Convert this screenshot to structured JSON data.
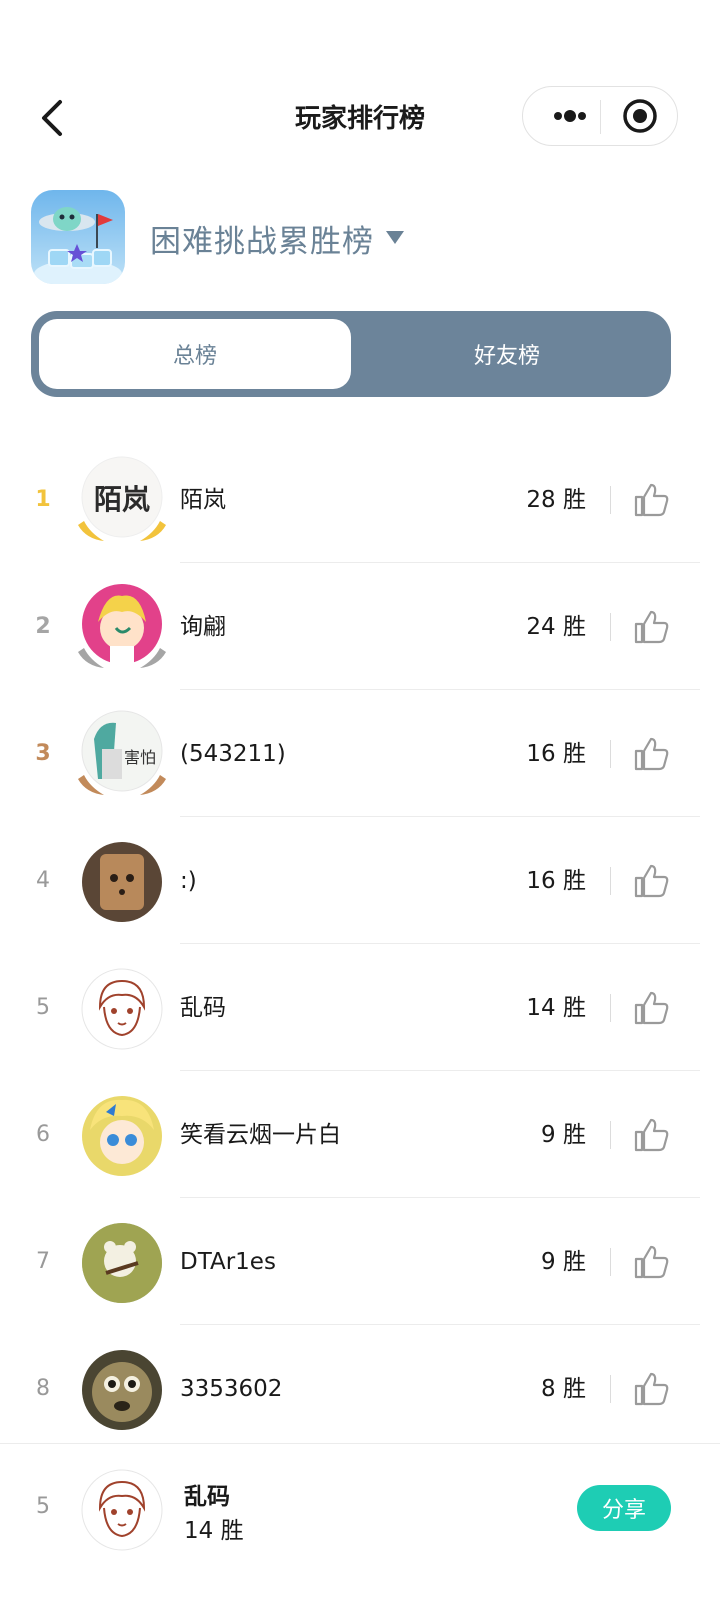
{
  "header": {
    "title": "玩家排行榜"
  },
  "board": {
    "name": "困难挑战累胜榜"
  },
  "tabs": [
    {
      "label": "总榜",
      "active": true
    },
    {
      "label": "好友榜",
      "active": false
    }
  ],
  "colors": {
    "accent": "#6c849a",
    "share": "#1ecdb4",
    "gold": "#f2c33c",
    "silver": "#a5a5a5",
    "bronze": "#c28a5a"
  },
  "leaderboard": [
    {
      "rank": "1",
      "name": "陌岚",
      "score": "28 胜",
      "avatar_text": "陌岚"
    },
    {
      "rank": "2",
      "name": "询翩",
      "score": "24 胜"
    },
    {
      "rank": "3",
      "name": "(543211)",
      "score": "16 胜",
      "avatar_text": "害怕"
    },
    {
      "rank": "4",
      "name": ":)",
      "score": "16 胜"
    },
    {
      "rank": "5",
      "name": "乱码",
      "score": "14 胜"
    },
    {
      "rank": "6",
      "name": "笑看云烟一片白",
      "score": "9 胜"
    },
    {
      "rank": "7",
      "name": "DTAr1es",
      "score": "9 胜"
    },
    {
      "rank": "8",
      "name": "3353602",
      "score": "8 胜"
    }
  ],
  "me": {
    "rank": "5",
    "name": "乱码",
    "score": "14 胜",
    "share_label": "分享"
  },
  "icons": {
    "back": "chevron-left-icon",
    "more": "more-dots-icon",
    "close": "target-circle-icon",
    "dropdown": "caret-down-icon",
    "like": "thumbs-up-icon"
  }
}
